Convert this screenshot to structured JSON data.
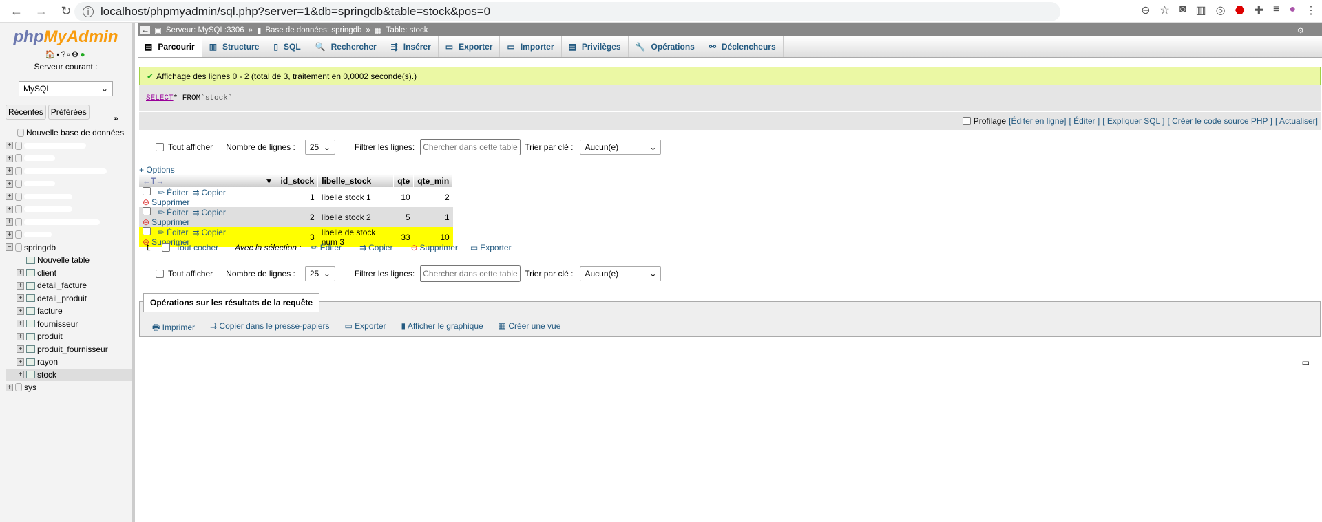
{
  "browser": {
    "url": "localhost/phpmyadmin/sql.php?server=1&db=springdb&table=stock&pos=0"
  },
  "sidebar": {
    "logo_a": "php",
    "logo_b": "MyAdmin",
    "server_label": "Serveur courant :",
    "server_select": "MySQL",
    "recent": "Récentes",
    "favorites": "Préférées",
    "new_db": "Nouvelle base de données",
    "db_springdb": "springdb",
    "new_table": "Nouvelle table",
    "tables": [
      "client",
      "detail_facture",
      "detail_produit",
      "facture",
      "fournisseur",
      "produit",
      "produit_fournisseur",
      "rayon",
      "stock"
    ],
    "db_sys": "sys"
  },
  "breadcrumb": {
    "server": "Serveur: MySQL:3306",
    "sep": "»",
    "database": "Base de données: springdb",
    "table": "Table: stock"
  },
  "tabs": [
    "Parcourir",
    "Structure",
    "SQL",
    "Rechercher",
    "Insérer",
    "Exporter",
    "Importer",
    "Privilèges",
    "Opérations",
    "Déclencheurs"
  ],
  "message": "Affichage des lignes 0 - 2 (total de 3, traitement en 0,0002 seconde(s).)",
  "query": {
    "kw1": "SELECT",
    "mid": " * FROM ",
    "table": "`stock`"
  },
  "query_links": {
    "profiling": "Profilage",
    "edit_inline": "[Éditer en ligne]",
    "edit": "[ Éditer ]",
    "explain": "[ Expliquer SQL ]",
    "php": "[ Créer le code source PHP ]",
    "refresh": "[ Actualiser]"
  },
  "nav": {
    "show_all": "Tout afficher",
    "rows_label": "Nombre de lignes :",
    "rows_value": "25",
    "filter_label": "Filtrer les lignes:",
    "filter_placeholder": "Chercher dans cette table",
    "sort_label": "Trier par clé :",
    "sort_value": "Aucun(e)"
  },
  "options": "+ Options",
  "table": {
    "columns": [
      "id_stock",
      "libelle_stock",
      "qte",
      "qte_min"
    ],
    "actions": {
      "edit": "Éditer",
      "copy": "Copier",
      "delete": "Supprimer"
    },
    "rows": [
      [
        "1",
        "libelle stock 1",
        "10",
        "2"
      ],
      [
        "2",
        "libelle stock 2",
        "5",
        "1"
      ],
      [
        "3",
        "libelle de stock num 3",
        "33",
        "10"
      ]
    ],
    "highlight_color": "#ffff00"
  },
  "bulk": {
    "check_all": "Tout cocher",
    "with_selection": "Avec la sélection :",
    "edit": "Éditer",
    "copy": "Copier",
    "delete": "Supprimer",
    "export": "Exporter"
  },
  "operations": {
    "title": "Opérations sur les résultats de la requête",
    "items": [
      "Imprimer",
      "Copier dans le presse-papiers",
      "Exporter",
      "Afficher le graphique",
      "Créer une vue"
    ]
  }
}
